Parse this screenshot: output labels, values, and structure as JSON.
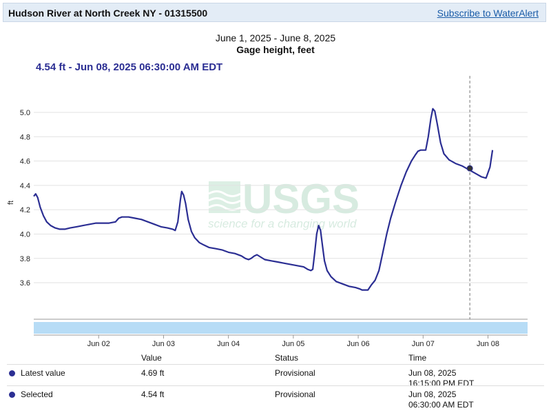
{
  "header": {
    "title": "Hudson River at North Creek NY - 01315500",
    "alert_link": "Subscribe to WaterAlert"
  },
  "readout": "4.54 ft - Jun 08, 2025 06:30:00 AM EDT",
  "colors": {
    "series": "#2b2e93",
    "header_bg": "#e3ecf6",
    "link": "#1a5ca8",
    "navigator": "#b7dcf6"
  },
  "watermark": {
    "logo": "USGS",
    "tagline": "science for a changing world"
  },
  "chart_data": {
    "type": "line",
    "title": "June 1, 2025 - June 8, 2025",
    "subtitle": "Gage height, feet",
    "ylabel": "ft",
    "xlabel": "",
    "xlim": [
      1.0,
      8.61
    ],
    "ylim": [
      3.3,
      5.3
    ],
    "yticks": [
      3.6,
      3.8,
      4.0,
      4.2,
      4.4,
      4.6,
      4.8,
      5.0
    ],
    "ytick_labels": [
      "3.6",
      "3.8",
      "4.0",
      "4.2",
      "4.4",
      "4.6",
      "4.8",
      "5.0"
    ],
    "xticks": [
      2,
      3,
      4,
      5,
      6,
      7,
      8
    ],
    "xtick_labels": [
      "Jun 02",
      "Jun 03",
      "Jun 04",
      "Jun 05",
      "Jun 06",
      "Jun 07",
      "Jun 08"
    ],
    "grid": true,
    "series": [
      {
        "values": [
          [
            1.0,
            4.31
          ],
          [
            1.03,
            4.33
          ],
          [
            1.06,
            4.3
          ],
          [
            1.1,
            4.22
          ],
          [
            1.15,
            4.15
          ],
          [
            1.2,
            4.1
          ],
          [
            1.26,
            4.07
          ],
          [
            1.33,
            4.05
          ],
          [
            1.4,
            4.04
          ],
          [
            1.48,
            4.04
          ],
          [
            1.56,
            4.05
          ],
          [
            1.66,
            4.06
          ],
          [
            1.76,
            4.07
          ],
          [
            1.86,
            4.08
          ],
          [
            1.96,
            4.09
          ],
          [
            2.06,
            4.09
          ],
          [
            2.16,
            4.09
          ],
          [
            2.26,
            4.1
          ],
          [
            2.31,
            4.13
          ],
          [
            2.36,
            4.14
          ],
          [
            2.46,
            4.14
          ],
          [
            2.56,
            4.13
          ],
          [
            2.66,
            4.12
          ],
          [
            2.76,
            4.1
          ],
          [
            2.86,
            4.08
          ],
          [
            2.96,
            4.06
          ],
          [
            3.06,
            4.05
          ],
          [
            3.14,
            4.04
          ],
          [
            3.18,
            4.03
          ],
          [
            3.22,
            4.1
          ],
          [
            3.26,
            4.28
          ],
          [
            3.28,
            4.35
          ],
          [
            3.31,
            4.32
          ],
          [
            3.34,
            4.25
          ],
          [
            3.38,
            4.12
          ],
          [
            3.43,
            4.02
          ],
          [
            3.48,
            3.97
          ],
          [
            3.55,
            3.93
          ],
          [
            3.62,
            3.91
          ],
          [
            3.7,
            3.89
          ],
          [
            3.8,
            3.88
          ],
          [
            3.9,
            3.87
          ],
          [
            4.0,
            3.85
          ],
          [
            4.1,
            3.84
          ],
          [
            4.2,
            3.82
          ],
          [
            4.26,
            3.8
          ],
          [
            4.31,
            3.79
          ],
          [
            4.35,
            3.8
          ],
          [
            4.4,
            3.82
          ],
          [
            4.44,
            3.83
          ],
          [
            4.5,
            3.81
          ],
          [
            4.56,
            3.79
          ],
          [
            4.66,
            3.78
          ],
          [
            4.76,
            3.77
          ],
          [
            4.86,
            3.76
          ],
          [
            4.96,
            3.75
          ],
          [
            5.06,
            3.74
          ],
          [
            5.16,
            3.73
          ],
          [
            5.22,
            3.71
          ],
          [
            5.27,
            3.7
          ],
          [
            5.3,
            3.71
          ],
          [
            5.33,
            3.85
          ],
          [
            5.36,
            4.0
          ],
          [
            5.39,
            4.07
          ],
          [
            5.42,
            4.03
          ],
          [
            5.45,
            3.9
          ],
          [
            5.48,
            3.78
          ],
          [
            5.52,
            3.7
          ],
          [
            5.58,
            3.65
          ],
          [
            5.66,
            3.61
          ],
          [
            5.76,
            3.59
          ],
          [
            5.86,
            3.57
          ],
          [
            5.96,
            3.56
          ],
          [
            6.02,
            3.55
          ],
          [
            6.06,
            3.54
          ],
          [
            6.15,
            3.54
          ],
          [
            6.2,
            3.58
          ],
          [
            6.26,
            3.62
          ],
          [
            6.32,
            3.7
          ],
          [
            6.38,
            3.85
          ],
          [
            6.44,
            4.0
          ],
          [
            6.5,
            4.13
          ],
          [
            6.58,
            4.27
          ],
          [
            6.66,
            4.4
          ],
          [
            6.74,
            4.51
          ],
          [
            6.82,
            4.6
          ],
          [
            6.88,
            4.65
          ],
          [
            6.92,
            4.68
          ],
          [
            6.96,
            4.69
          ],
          [
            7.0,
            4.69
          ],
          [
            7.04,
            4.69
          ],
          [
            7.08,
            4.8
          ],
          [
            7.12,
            4.95
          ],
          [
            7.15,
            5.03
          ],
          [
            7.18,
            5.01
          ],
          [
            7.22,
            4.9
          ],
          [
            7.27,
            4.75
          ],
          [
            7.32,
            4.66
          ],
          [
            7.4,
            4.61
          ],
          [
            7.5,
            4.58
          ],
          [
            7.6,
            4.56
          ],
          [
            7.7,
            4.53
          ],
          [
            7.8,
            4.5
          ],
          [
            7.9,
            4.47
          ],
          [
            7.97,
            4.46
          ],
          [
            8.03,
            4.55
          ],
          [
            8.07,
            4.69
          ]
        ]
      }
    ],
    "selected_x": 7.72,
    "selected_y": 4.54
  },
  "table": {
    "headers": [
      "Value",
      "Status",
      "Time"
    ],
    "rows": [
      {
        "label": "Latest value",
        "value": "4.69 ft",
        "status": "Provisional",
        "date": "Jun 08, 2025",
        "time": "16:15:00 PM EDT"
      },
      {
        "label": "Selected",
        "value": "4.54 ft",
        "status": "Provisional",
        "date": "Jun 08, 2025",
        "time": "06:30:00 AM EDT"
      }
    ]
  }
}
